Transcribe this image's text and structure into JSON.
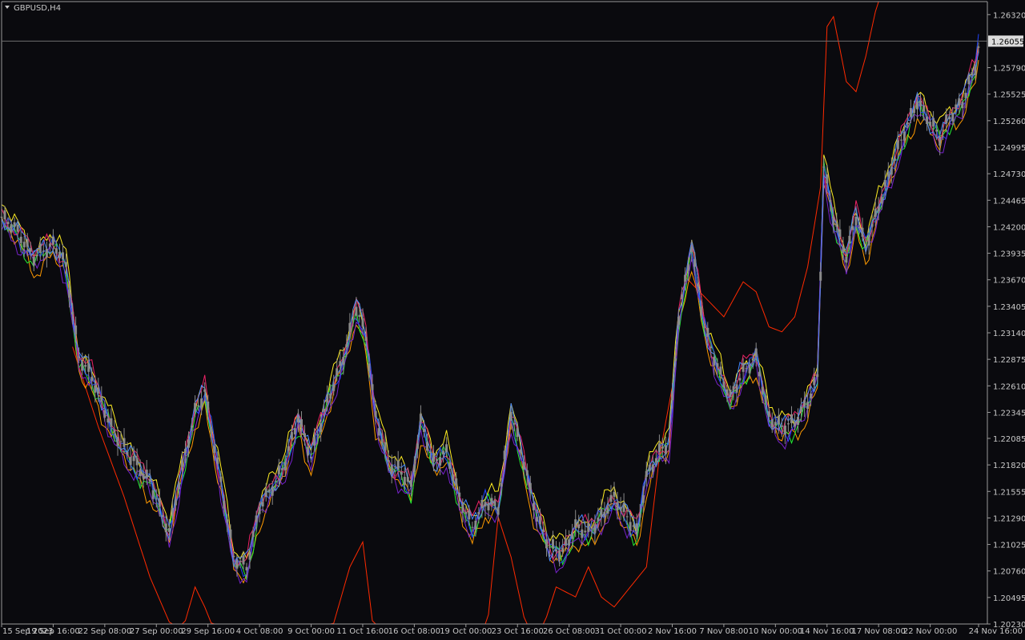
{
  "symbol_label": "GBPUSD,H4",
  "price_tag": "1.26055",
  "icons": {
    "symbol_menu": "triangle-down-icon"
  },
  "colors": {
    "background": "#0a0a0e",
    "axis": "#9a9a9a",
    "text": "#c8c8c8",
    "candle": "#8a8a8a",
    "price_line": "#6e6e6e",
    "tag_bg": "#dcdcdc",
    "tag_text": "#000000"
  },
  "chart_data": {
    "type": "line",
    "symbol": "GBPUSD",
    "timeframe": "H4",
    "ylim": [
      1.2023,
      1.2645
    ],
    "current_price": 1.26055,
    "y_ticks": [
      "1.26320",
      "1.25790",
      "1.25525",
      "1.25260",
      "1.24995",
      "1.24730",
      "1.24465",
      "1.24200",
      "1.23935",
      "1.23670",
      "1.23405",
      "1.23140",
      "1.22875",
      "1.22610",
      "1.22345",
      "1.22085",
      "1.21820",
      "1.21555",
      "1.21290",
      "1.21025",
      "1.20760",
      "1.20495",
      "1.20230"
    ],
    "x_ticks": [
      "15 Sep 2023",
      "19 Sep 16:00",
      "22 Sep 08:00",
      "27 Sep 00:00",
      "29 Sep 16:00",
      "4 Oct 08:00",
      "9 Oct 00:00",
      "11 Oct 16:00",
      "16 Oct 08:00",
      "19 Oct 00:00",
      "23 Oct 16:00",
      "26 Oct 08:00",
      "31 Oct 00:00",
      "2 Nov 16:00",
      "7 Nov 08:00",
      "10 Nov 00:00",
      "14 Nov 16:00",
      "17 Nov 08:00",
      "22 Nov 00:00",
      "24 Nov 16:00"
    ],
    "x_tick_index": [
      0,
      16,
      32,
      48,
      64,
      80,
      96,
      112,
      128,
      144,
      160,
      176,
      192,
      208,
      224,
      240,
      256,
      272,
      288,
      303
    ],
    "price_anchors": [
      [
        0,
        1.243
      ],
      [
        4,
        1.242
      ],
      [
        10,
        1.239
      ],
      [
        16,
        1.2402
      ],
      [
        18,
        1.2395
      ],
      [
        20,
        1.238
      ],
      [
        24,
        1.229
      ],
      [
        28,
        1.227
      ],
      [
        34,
        1.222
      ],
      [
        40,
        1.219
      ],
      [
        46,
        1.2165
      ],
      [
        52,
        1.2115
      ],
      [
        56,
        1.218
      ],
      [
        60,
        1.2235
      ],
      [
        63,
        1.2255
      ],
      [
        68,
        1.2165
      ],
      [
        72,
        1.209
      ],
      [
        76,
        1.208
      ],
      [
        80,
        1.214
      ],
      [
        84,
        1.216
      ],
      [
        88,
        1.2185
      ],
      [
        92,
        1.223
      ],
      [
        96,
        1.219
      ],
      [
        100,
        1.2235
      ],
      [
        106,
        1.229
      ],
      [
        110,
        1.234
      ],
      [
        113,
        1.231
      ],
      [
        116,
        1.223
      ],
      [
        120,
        1.2185
      ],
      [
        124,
        1.2175
      ],
      [
        127,
        1.216
      ],
      [
        130,
        1.2225
      ],
      [
        134,
        1.2185
      ],
      [
        138,
        1.2195
      ],
      [
        142,
        1.215
      ],
      [
        146,
        1.212
      ],
      [
        150,
        1.2145
      ],
      [
        154,
        1.214
      ],
      [
        158,
        1.2235
      ],
      [
        162,
        1.2185
      ],
      [
        166,
        1.213
      ],
      [
        170,
        1.21
      ],
      [
        174,
        1.2095
      ],
      [
        178,
        1.212
      ],
      [
        182,
        1.2115
      ],
      [
        186,
        1.213
      ],
      [
        190,
        1.215
      ],
      [
        193,
        1.2135
      ],
      [
        197,
        1.2115
      ],
      [
        200,
        1.217
      ],
      [
        204,
        1.2195
      ],
      [
        207,
        1.2205
      ],
      [
        210,
        1.233
      ],
      [
        214,
        1.24
      ],
      [
        218,
        1.232
      ],
      [
        222,
        1.228
      ],
      [
        226,
        1.225
      ],
      [
        230,
        1.2275
      ],
      [
        234,
        1.229
      ],
      [
        238,
        1.223
      ],
      [
        242,
        1.222
      ],
      [
        246,
        1.2225
      ],
      [
        250,
        1.2245
      ],
      [
        253,
        1.227
      ],
      [
        255,
        1.248
      ],
      [
        258,
        1.243
      ],
      [
        262,
        1.239
      ],
      [
        265,
        1.243
      ],
      [
        268,
        1.24
      ],
      [
        272,
        1.244
      ],
      [
        276,
        1.248
      ],
      [
        280,
        1.2515
      ],
      [
        284,
        1.2545
      ],
      [
        288,
        1.2525
      ],
      [
        291,
        1.251
      ],
      [
        294,
        1.253
      ],
      [
        298,
        1.2545
      ],
      [
        302,
        1.258
      ],
      [
        303,
        1.26
      ]
    ],
    "series": [
      {
        "color": "#ff2a00",
        "offset": -0.003,
        "anchors": [
          [
            22,
            1.23
          ],
          [
            30,
            1.222
          ],
          [
            38,
            1.215
          ],
          [
            46,
            1.207
          ],
          [
            52,
            1.2025
          ],
          [
            56,
            1.2015
          ],
          [
            60,
            1.206
          ],
          [
            63,
            1.204
          ],
          [
            68,
            1.2
          ],
          [
            100,
            1.199
          ],
          [
            108,
            1.208
          ],
          [
            112,
            1.2105
          ],
          [
            116,
            1.2
          ],
          [
            150,
            1.2
          ],
          [
            154,
            1.213
          ],
          [
            158,
            1.209
          ],
          [
            162,
            1.203
          ],
          [
            166,
            1.2
          ],
          [
            172,
            1.206
          ],
          [
            178,
            1.205
          ],
          [
            182,
            1.208
          ],
          [
            186,
            1.205
          ],
          [
            190,
            1.204
          ],
          [
            200,
            1.208
          ],
          [
            204,
            1.219
          ],
          [
            208,
            1.226
          ],
          [
            212,
            1.237
          ],
          [
            218,
            1.235
          ],
          [
            224,
            1.233
          ],
          [
            230,
            1.2365
          ],
          [
            234,
            1.2355
          ],
          [
            238,
            1.232
          ],
          [
            242,
            1.2315
          ],
          [
            246,
            1.233
          ],
          [
            250,
            1.238
          ],
          [
            254,
            1.246
          ],
          [
            256,
            1.262
          ],
          [
            258,
            1.263
          ],
          [
            262,
            1.2565
          ],
          [
            265,
            1.2555
          ],
          [
            268,
            1.259
          ],
          [
            272,
            1.265
          ]
        ]
      },
      {
        "color": "#ff9a00",
        "offset": -0.0012
      },
      {
        "color": "#ffee22",
        "offset": 0.0008
      },
      {
        "color": "#22ee33",
        "offset": -0.0005
      },
      {
        "color": "#2244ff",
        "offset": -0.0002
      },
      {
        "color": "#7722cc",
        "offset": -0.001
      },
      {
        "color": "#ee2266",
        "offset": 0.0003
      },
      {
        "color": "#4488ff",
        "offset": 0.0001
      }
    ]
  }
}
